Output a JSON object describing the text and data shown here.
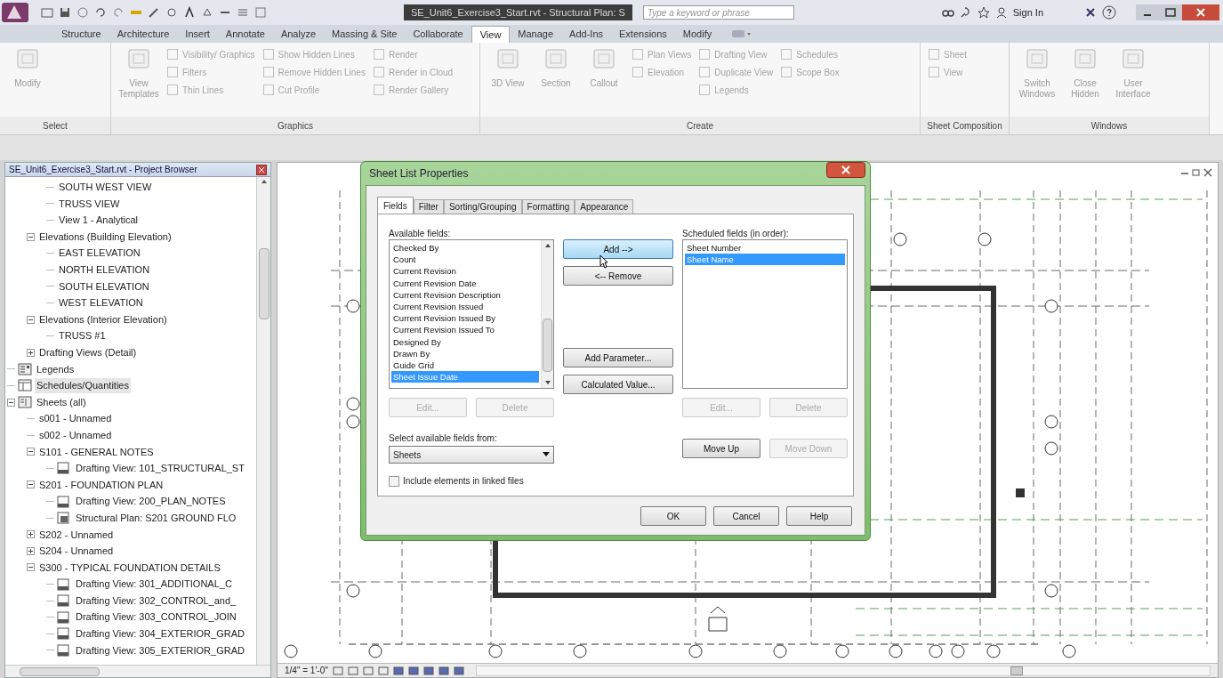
{
  "app": {
    "title": "SE_Unit6_Exercise3_Start.rvt - Structural Plan: S",
    "search": {
      "placeholder": "Type a keyword or phrase"
    },
    "sign_in": "Sign In"
  },
  "ribbon_tabs": [
    {
      "label": "Structure",
      "selected": false
    },
    {
      "label": "Architecture",
      "selected": false
    },
    {
      "label": "Insert",
      "selected": false
    },
    {
      "label": "Annotate",
      "selected": false
    },
    {
      "label": "Analyze",
      "selected": false
    },
    {
      "label": "Massing & Site",
      "selected": false
    },
    {
      "label": "Collaborate",
      "selected": false
    },
    {
      "label": "View",
      "selected": true
    },
    {
      "label": "Manage",
      "selected": false
    },
    {
      "label": "Add-Ins",
      "selected": false
    },
    {
      "label": "Extensions",
      "selected": false
    },
    {
      "label": "Modify",
      "selected": false
    }
  ],
  "ribbon_panels": [
    {
      "label": "Select",
      "tools": [
        {
          "kind": "large",
          "label": "Modify"
        }
      ]
    },
    {
      "label": "Graphics",
      "tools": [
        {
          "kind": "large",
          "label": "View Templates"
        },
        {
          "kind": "stack",
          "items": [
            "Visibility/ Graphics",
            "Filters",
            "Thin Lines"
          ]
        },
        {
          "kind": "stack",
          "items": [
            "Show Hidden Lines",
            "Remove Hidden Lines",
            "Cut Profile"
          ]
        },
        {
          "kind": "stack",
          "items": [
            "Render",
            "Render in Cloud",
            "Render Gallery"
          ]
        }
      ]
    },
    {
      "label": "Create",
      "tools": [
        {
          "kind": "large",
          "label": "3D View"
        },
        {
          "kind": "large",
          "label": "Section"
        },
        {
          "kind": "large",
          "label": "Callout"
        },
        {
          "kind": "stack",
          "items": [
            "Plan Views",
            "Elevation"
          ]
        },
        {
          "kind": "stack",
          "items": [
            "Drafting View",
            "Duplicate View",
            "Legends"
          ]
        },
        {
          "kind": "stack",
          "items": [
            "Schedules",
            "Scope Box"
          ]
        }
      ]
    },
    {
      "label": "Sheet Composition",
      "tools": [
        {
          "kind": "stack",
          "items": [
            "Sheet",
            "View"
          ]
        }
      ]
    },
    {
      "label": "Windows",
      "tools": [
        {
          "kind": "large",
          "label": "Switch Windows"
        },
        {
          "kind": "large",
          "label": "Close Hidden"
        },
        {
          "kind": "large",
          "label": "User Interface"
        }
      ]
    }
  ],
  "project_browser": {
    "title": "SE_Unit6_Exercise3_Start.rvt - Project Browser",
    "tree": [
      {
        "children": [
          {
            "children": [
              {
                "label": "SOUTH WEST VIEW",
                "selected": false
              },
              {
                "label": "TRUSS VIEW",
                "selected": false
              },
              {
                "label": "View 1 - Analytical",
                "selected": false
              }
            ]
          },
          {
            "label": "Elevations (Building Elevation)",
            "selected": false,
            "expanded": true,
            "children": [
              {
                "label": "EAST ELEVATION",
                "selected": false
              },
              {
                "label": "NORTH ELEVATION",
                "selected": false
              },
              {
                "label": "SOUTH ELEVATION",
                "selected": false
              },
              {
                "label": "WEST ELEVATION",
                "selected": false
              }
            ]
          },
          {
            "label": "Elevations (Interior Elevation)",
            "selected": false,
            "expanded": true,
            "children": [
              {
                "label": "TRUSS #1",
                "selected": false
              }
            ]
          },
          {
            "label": "Drafting Views (Detail)",
            "selected": false,
            "expanded": false
          }
        ]
      },
      {
        "label": "Legends",
        "kind": "legends",
        "selected": false
      },
      {
        "label": "Schedules/Quantities",
        "kind": "schedules",
        "selected": true
      },
      {
        "label": "Sheets (all)",
        "kind": "sheets",
        "selected": false,
        "expanded": true,
        "children": [
          {
            "label": "s001 - Unnamed",
            "selected": false
          },
          {
            "label": "s002 - Unnamed",
            "selected": false
          },
          {
            "label": "S101 - GENERAL NOTES",
            "selected": false,
            "expanded": true,
            "children": [
              {
                "label": "Drafting View: 101_STRUCTURAL_ST",
                "kind": "drafting",
                "selected": false
              }
            ]
          },
          {
            "label": "S201 - FOUNDATION PLAN",
            "selected": false,
            "expanded": true,
            "children": [
              {
                "label": "Drafting View: 200_PLAN_NOTES",
                "kind": "drafting",
                "selected": false
              },
              {
                "label": "Structural Plan: S201 GROUND FLO",
                "kind": "plan",
                "selected": false
              }
            ]
          },
          {
            "label": "S202 - Unnamed",
            "selected": false,
            "expanded": false
          },
          {
            "label": "S204 - Unnamed",
            "selected": false,
            "expanded": false
          },
          {
            "label": "S300 - TYPICAL FOUNDATION DETAILS",
            "selected": false,
            "expanded": true,
            "children": [
              {
                "label": "Drafting View: 301_ADDITIONAL_C",
                "kind": "drafting",
                "selected": false
              },
              {
                "label": "Drafting View: 302_CONTROL_and_",
                "kind": "drafting",
                "selected": false
              },
              {
                "label": "Drafting View: 303_CONTROL_JOIN",
                "kind": "drafting",
                "selected": false
              },
              {
                "label": "Drafting View: 304_EXTERIOR_GRAD",
                "kind": "drafting",
                "selected": false
              },
              {
                "label": "Drafting View: 305_EXTERIOR_GRAD",
                "kind": "drafting",
                "selected": false
              }
            ]
          }
        ]
      }
    ]
  },
  "view": {
    "scale": "1/4\" = 1'-0\""
  },
  "dialog": {
    "title": "Sheet List Properties",
    "tabs": [
      {
        "label": "Fields",
        "selected": true
      },
      {
        "label": "Filter",
        "selected": false
      },
      {
        "label": "Sorting/Grouping",
        "selected": false
      },
      {
        "label": "Formatting",
        "selected": false
      },
      {
        "label": "Appearance",
        "selected": false
      }
    ],
    "available_label": "Available fields:",
    "available_fields": [
      {
        "label": "Checked By",
        "selected": false
      },
      {
        "label": "Count",
        "selected": false
      },
      {
        "label": "Current Revision",
        "selected": false
      },
      {
        "label": "Current Revision Date",
        "selected": false
      },
      {
        "label": "Current Revision Description",
        "selected": false
      },
      {
        "label": "Current Revision Issued",
        "selected": false
      },
      {
        "label": "Current Revision Issued By",
        "selected": false
      },
      {
        "label": "Current Revision Issued To",
        "selected": false
      },
      {
        "label": "Designed By",
        "selected": false
      },
      {
        "label": "Drawn By",
        "selected": false
      },
      {
        "label": "Guide Grid",
        "selected": false
      },
      {
        "label": "Sheet Issue Date",
        "selected": true
      }
    ],
    "available_buttons": [
      {
        "label": "Edit...",
        "disabled": true
      },
      {
        "label": "Delete",
        "disabled": true
      }
    ],
    "middle_buttons": [
      {
        "label": "Add -->",
        "hovered": true
      },
      {
        "label": "<-- Remove",
        "hovered": false
      },
      {
        "label": "Add Parameter...",
        "hovered": false
      },
      {
        "label": "Calculated Value...",
        "hovered": false
      }
    ],
    "scheduled_label": "Scheduled fields (in order):",
    "scheduled_fields": [
      {
        "label": "Sheet Number",
        "selected": false
      },
      {
        "label": "Sheet Name",
        "selected": true
      }
    ],
    "scheduled_buttons": [
      {
        "label": "Edit...",
        "disabled": true
      },
      {
        "label": "Delete",
        "disabled": true
      }
    ],
    "select_from_label": "Select available fields from:",
    "select_from_value": "Sheets",
    "order_buttons": [
      {
        "label": "Move Up",
        "disabled": false
      },
      {
        "label": "Move Down",
        "disabled": true
      }
    ],
    "include_linked": {
      "label": "Include elements in linked files",
      "checked": false
    },
    "footer_buttons": [
      "OK",
      "Cancel",
      "Help"
    ]
  }
}
